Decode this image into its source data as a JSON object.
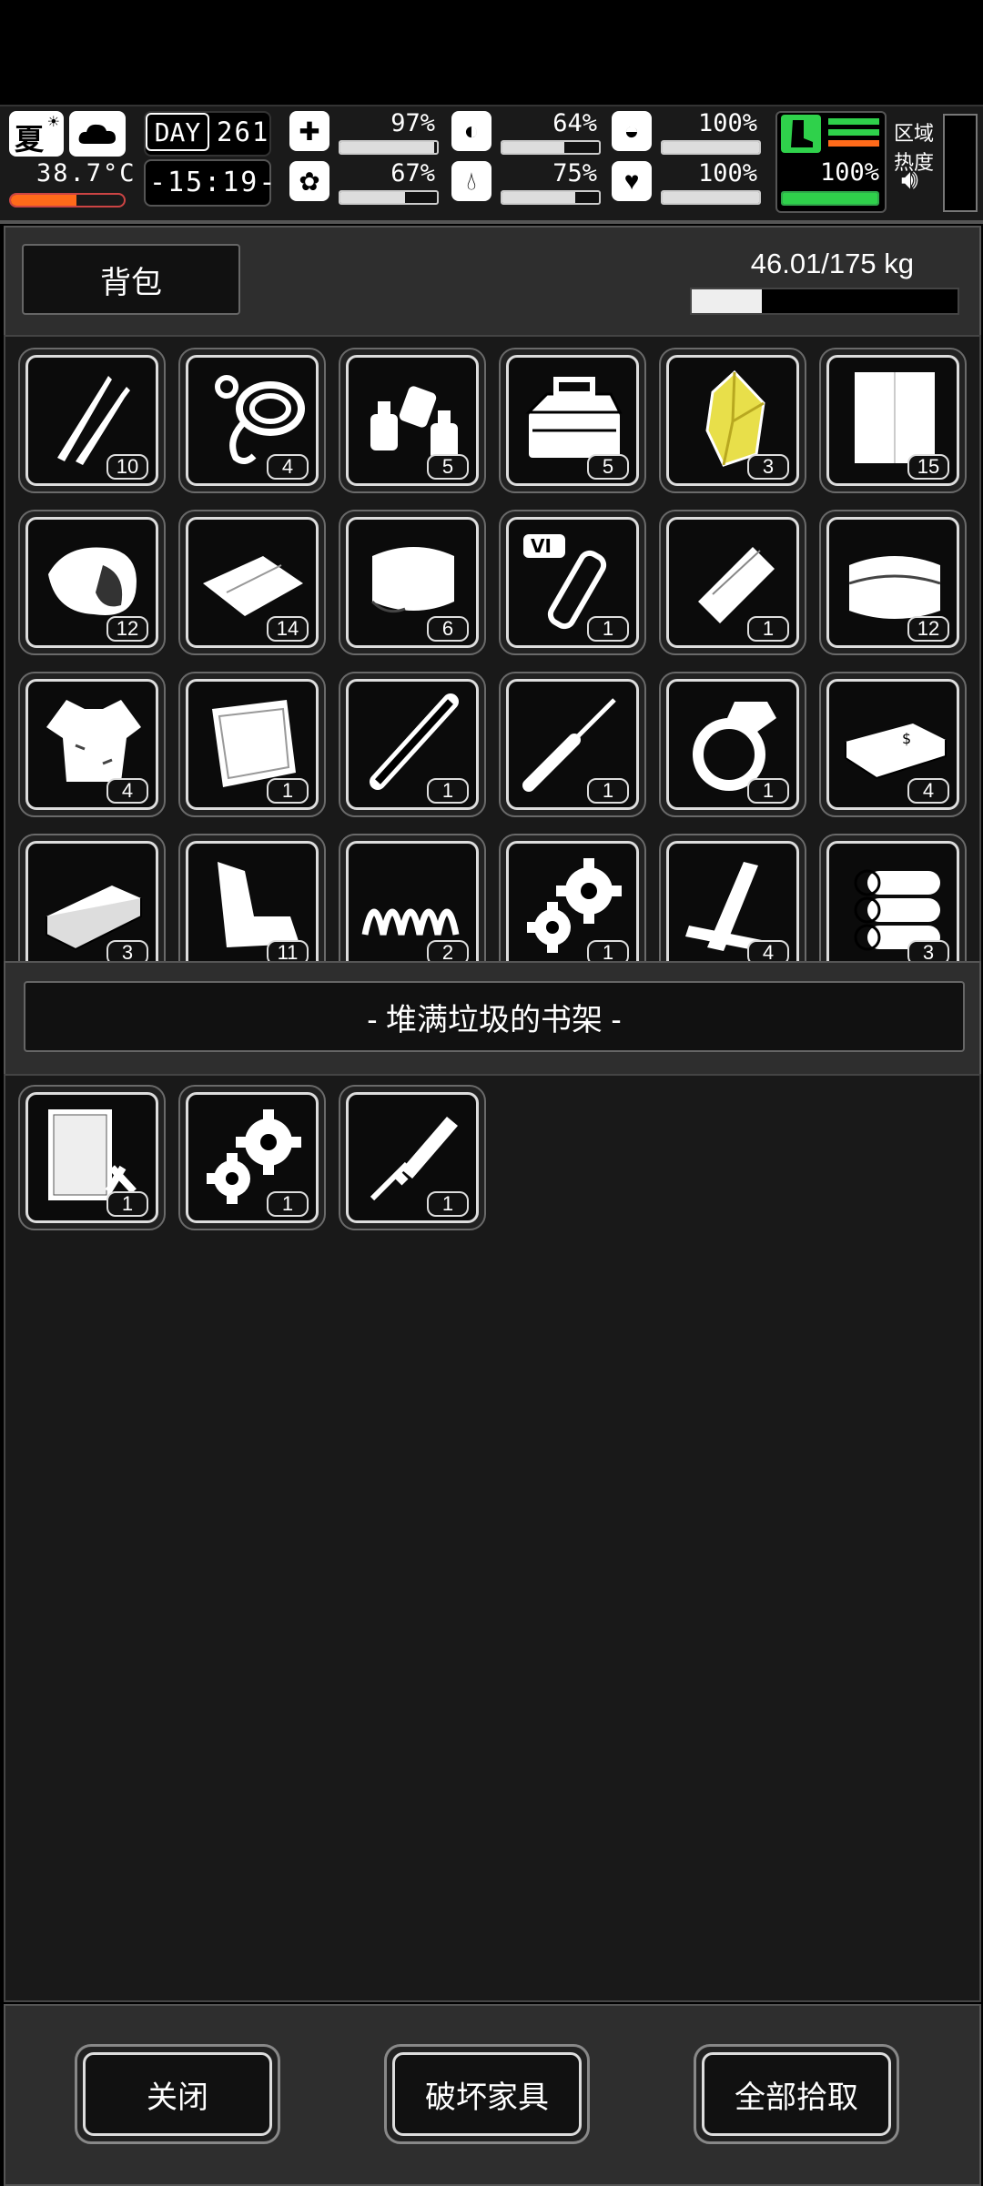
{
  "hud": {
    "season": "夏",
    "temperature": "38.7°C",
    "day_label": "DAY",
    "day_number": "261",
    "time": "-15:19-",
    "stats": [
      {
        "name": "health",
        "icon": "medkit-icon",
        "value": "97%",
        "fill": 0.97
      },
      {
        "name": "hunger",
        "icon": "stomach-icon",
        "value": "64%",
        "fill": 0.64
      },
      {
        "name": "armor",
        "icon": "helmet-icon",
        "value": "100%",
        "fill": 1.0
      },
      {
        "name": "sanity",
        "icon": "brain-icon",
        "value": "67%",
        "fill": 0.67
      },
      {
        "name": "thirst",
        "icon": "water-drop-icon",
        "value": "75%",
        "fill": 0.75
      },
      {
        "name": "heart",
        "icon": "heart-icon",
        "value": "100%",
        "fill": 1.0
      }
    ],
    "stamina": {
      "value": "100%",
      "fill": 1.0
    },
    "area_heat_label_line1": "区域",
    "area_heat_label_line2": "热度"
  },
  "backpack": {
    "title": "背包",
    "weight": "46.01/175 kg",
    "weight_fill": 0.263,
    "items": [
      {
        "icon": "lockpick-icon",
        "count": "10"
      },
      {
        "icon": "rope-icon",
        "count": "4"
      },
      {
        "icon": "glue-bottles-icon",
        "count": "5"
      },
      {
        "icon": "toolbox-icon",
        "count": "5"
      },
      {
        "icon": "yellow-crystal-icon",
        "count": "3"
      },
      {
        "icon": "paper-sheet-icon",
        "count": "15"
      },
      {
        "icon": "meat-icon",
        "count": "12"
      },
      {
        "icon": "cloth-rags-icon",
        "count": "14"
      },
      {
        "icon": "towel-icon",
        "count": "6"
      },
      {
        "icon": "test-tube-icon",
        "count": "1"
      },
      {
        "icon": "bandage-roll-icon",
        "count": "1"
      },
      {
        "icon": "folded-cloth-icon",
        "count": "12"
      },
      {
        "icon": "torn-shirt-icon",
        "count": "4"
      },
      {
        "icon": "plastic-sheet-icon",
        "count": "1"
      },
      {
        "icon": "pipe-icon",
        "count": "1"
      },
      {
        "icon": "screwdriver-icon",
        "count": "1"
      },
      {
        "icon": "ring-icon",
        "count": "1"
      },
      {
        "icon": "cash-stack-icon",
        "count": "4"
      },
      {
        "icon": "brick-icon",
        "count": "3"
      },
      {
        "icon": "scrap-metal-icon",
        "count": "11"
      },
      {
        "icon": "spring-icon",
        "count": "2"
      },
      {
        "icon": "gears-icon",
        "count": "1"
      },
      {
        "icon": "planks-icon",
        "count": "4"
      },
      {
        "icon": "logs-icon",
        "count": "3"
      }
    ],
    "tube_badge": "VI"
  },
  "container": {
    "title": "- 堆满垃圾的书架 -",
    "items": [
      {
        "icon": "blueprint-icon",
        "count": "1"
      },
      {
        "icon": "gears-icon",
        "count": "1"
      },
      {
        "icon": "file-tool-icon",
        "count": "1"
      }
    ]
  },
  "buttons": {
    "close": "关闭",
    "destroy": "破坏家具",
    "take_all": "全部拾取"
  }
}
